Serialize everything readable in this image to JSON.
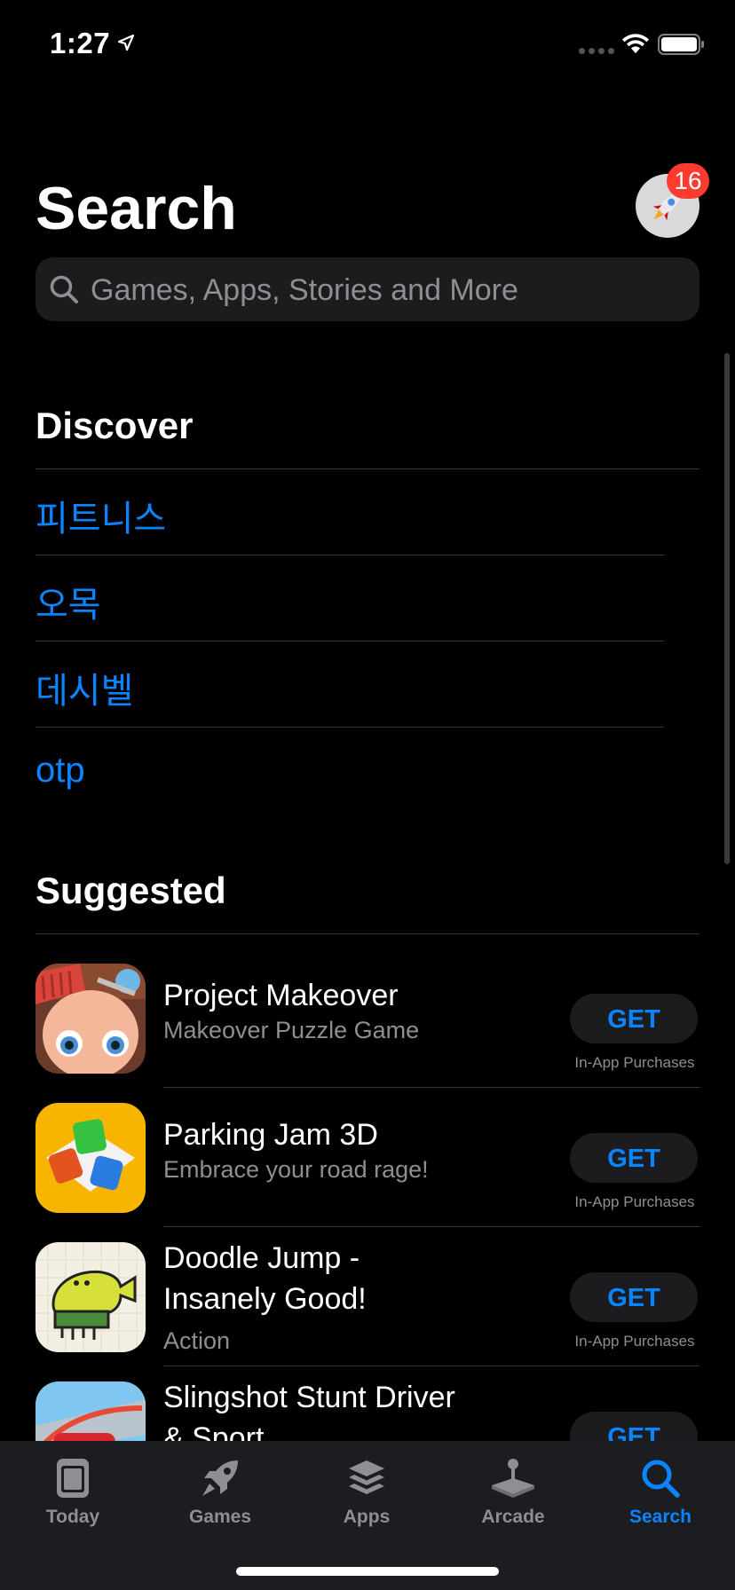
{
  "status_bar": {
    "time": "1:27"
  },
  "header": {
    "title": "Search",
    "badge_count": "16"
  },
  "search": {
    "placeholder": "Games, Apps, Stories and More"
  },
  "discover": {
    "title": "Discover",
    "items": [
      "피트니스",
      "오목",
      "데시벨",
      "otp"
    ]
  },
  "suggested": {
    "title": "Suggested",
    "apps": [
      {
        "name": "Project Makeover",
        "subtitle": "Makeover Puzzle Game",
        "button": "GET",
        "note": "In-App Purchases"
      },
      {
        "name": "Parking Jam 3D",
        "subtitle": "Embrace your road rage!",
        "button": "GET",
        "note": "In-App Purchases"
      },
      {
        "name_line1": "Doodle Jump -",
        "name_line2": "Insanely Good!",
        "subtitle": "Action",
        "button": "GET",
        "note": "In-App Purchases"
      },
      {
        "name_line1": "Slingshot Stunt Driver",
        "name_line2": "& Sport",
        "button": "GET"
      }
    ]
  },
  "tab_bar": {
    "tabs": [
      {
        "label": "Today",
        "icon": "today-icon"
      },
      {
        "label": "Games",
        "icon": "rocket-icon"
      },
      {
        "label": "Apps",
        "icon": "stack-icon"
      },
      {
        "label": "Arcade",
        "icon": "joystick-icon"
      },
      {
        "label": "Search",
        "icon": "search-icon",
        "active": true
      }
    ]
  },
  "colors": {
    "accent": "#0a84ff",
    "badge": "#ff3b30",
    "background": "#000000",
    "secondary_text": "#8e8e93"
  }
}
